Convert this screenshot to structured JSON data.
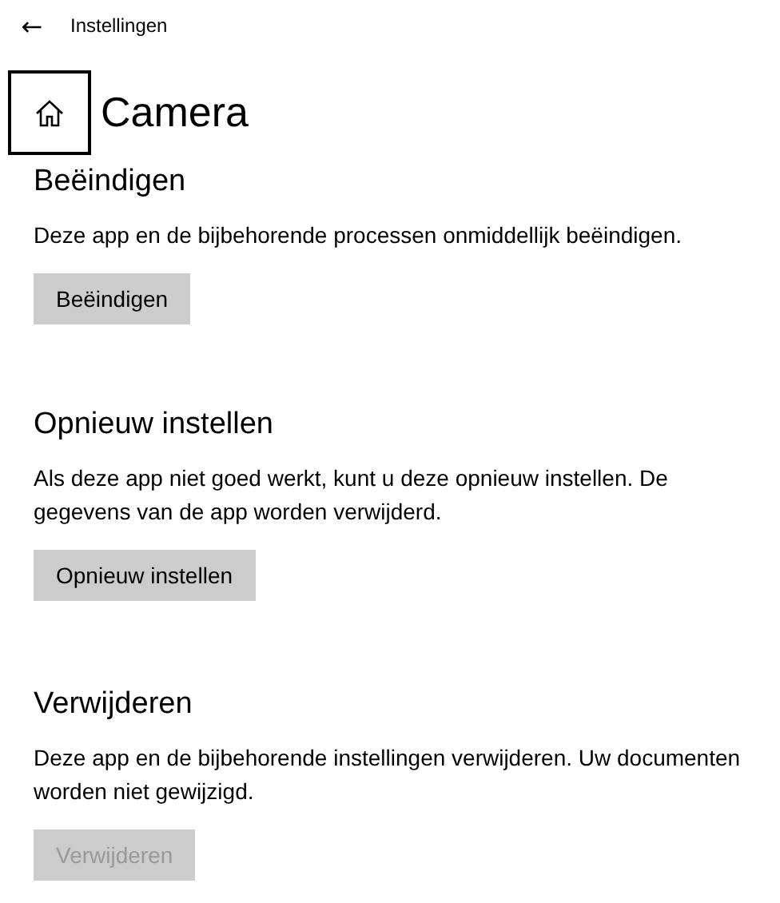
{
  "window": {
    "title": "Instellingen",
    "back": "←"
  },
  "page": {
    "title": "Camera"
  },
  "sections": [
    {
      "heading": "Beëindigen",
      "description": "Deze app en de bijbehorende processen onmiddellijk beëindigen.",
      "button": {
        "label": "Beëindigen",
        "disabled": false
      }
    },
    {
      "heading": "Opnieuw instellen",
      "description": "Als deze app niet goed werkt, kunt u deze opnieuw instellen. De gegevens van de app worden verwijderd.",
      "button": {
        "label": "Opnieuw instellen",
        "disabled": false
      }
    },
    {
      "heading": "Verwijderen",
      "description": "Deze app en de bijbehorende instellingen verwijderen. Uw documenten worden niet gewijzigd.",
      "button": {
        "label": "Verwijderen",
        "disabled": true
      }
    }
  ]
}
